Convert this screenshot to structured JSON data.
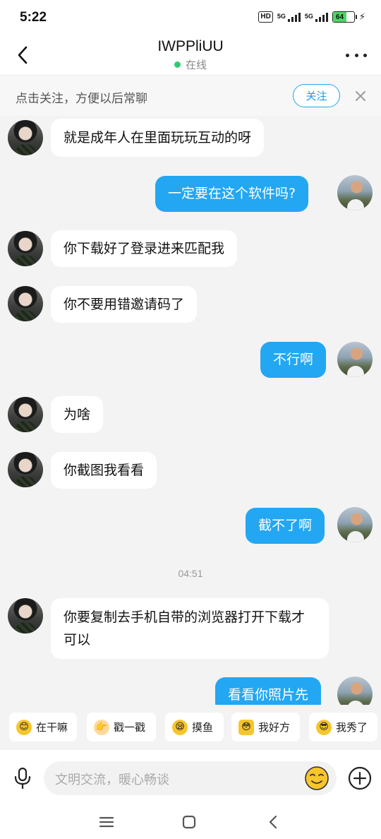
{
  "status_bar": {
    "time": "5:22",
    "hd": "HD",
    "net1": "5G",
    "net2": "5G",
    "battery": "64"
  },
  "header": {
    "title": "IWPPliUU",
    "status": "在线"
  },
  "follow_bar": {
    "text": "点击关注，方便以后常聊",
    "button": "关注"
  },
  "messages": [
    {
      "side": "in",
      "text": "就是成年人在里面玩玩互动的呀"
    },
    {
      "side": "out",
      "text": "一定要在这个软件吗?"
    },
    {
      "side": "in",
      "text": "你下载好了登录进来匹配我"
    },
    {
      "side": "in",
      "text": "你不要用错邀请码了"
    },
    {
      "side": "out",
      "text": "不行啊"
    },
    {
      "side": "in",
      "text": "为啥"
    },
    {
      "side": "in",
      "text": "你截图我看看"
    },
    {
      "side": "out",
      "text": "截不了啊"
    },
    {
      "side": "in",
      "text": "你要复制去手机自带的浏览器打开下载才可以"
    },
    {
      "side": "out",
      "text": "看看你照片先"
    }
  ],
  "time_separator": "04:51",
  "quick_replies": [
    "在干嘛",
    "戳一戳",
    "摸鱼",
    "我好方",
    "我秀了"
  ],
  "input": {
    "placeholder": "文明交流，暖心畅谈"
  },
  "icons": {
    "back": "chevron-left-icon",
    "more": "more-icon",
    "close": "close-icon",
    "mic": "microphone-icon",
    "emoji": "smiley-icon",
    "plus": "plus-icon",
    "nav_menu": "menu-icon",
    "nav_home": "home-icon",
    "nav_back": "back-icon"
  },
  "colors": {
    "accent": "#23a7f2",
    "online": "#2ecc71",
    "bubble_out": "#23a7f2"
  }
}
